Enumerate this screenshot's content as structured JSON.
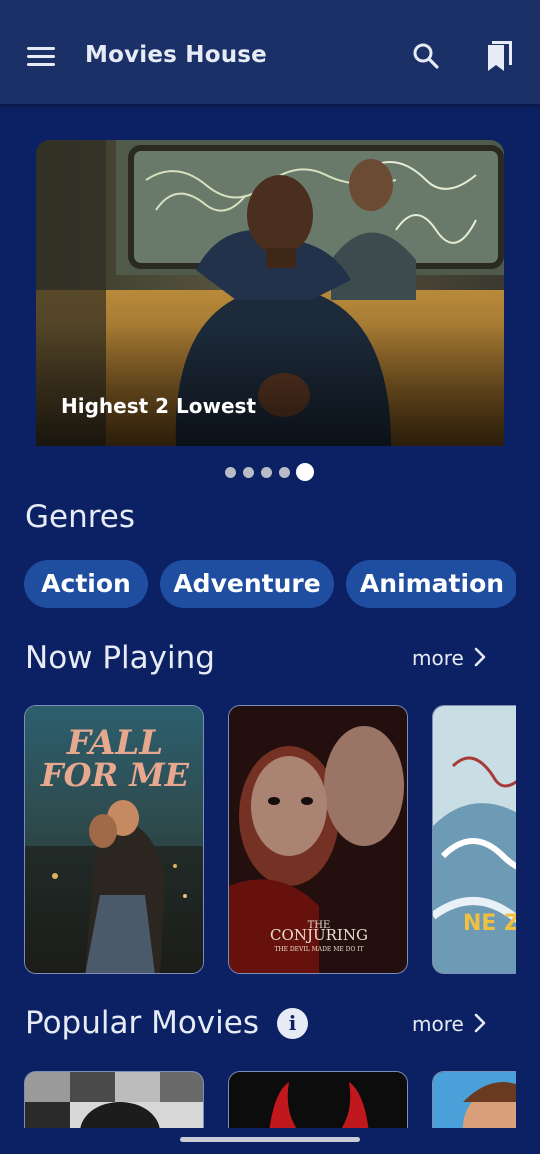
{
  "app": {
    "title": "Movies House"
  },
  "banner": {
    "title": "Highest 2 Lowest",
    "slide_count": 5,
    "active_slide": 5
  },
  "genres": {
    "title": "Genres",
    "items": [
      "Action",
      "Adventure",
      "Animation"
    ]
  },
  "now_playing": {
    "title": "Now Playing",
    "more_label": "more",
    "posters": [
      {
        "title_line1": "FALL",
        "title_line2": "FOR ME"
      },
      {
        "title_line1": "THE",
        "title_line2": "CONJURING",
        "tagline": "THE DEVIL MADE ME DO IT"
      },
      {
        "title_line1": "NE Z"
      }
    ]
  },
  "popular": {
    "title": "Popular Movies",
    "more_label": "more",
    "info_glyph": "i"
  },
  "colors": {
    "background": "#0b2163",
    "app_bar": "#1a3066",
    "chip": "#1f4ea0",
    "text": "#e6ebf5"
  }
}
